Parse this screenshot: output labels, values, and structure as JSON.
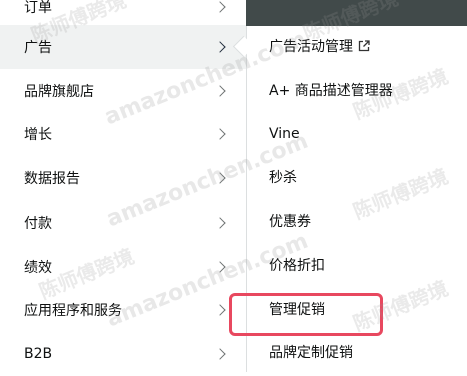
{
  "left_menu": {
    "items": [
      {
        "label": "订单",
        "active": false
      },
      {
        "label": "广告",
        "active": true
      },
      {
        "label": "品牌旗舰店",
        "active": false
      },
      {
        "label": "增长",
        "active": false
      },
      {
        "label": "数据报告",
        "active": false
      },
      {
        "label": "付款",
        "active": false
      },
      {
        "label": "绩效",
        "active": false
      },
      {
        "label": "应用程序和服务",
        "active": false
      },
      {
        "label": "B2B",
        "active": false
      }
    ]
  },
  "submenu": {
    "items": [
      {
        "label": "广告活动管理",
        "external": true
      },
      {
        "label": "A+ 商品描述管理器",
        "external": false
      },
      {
        "label": "Vine",
        "external": false
      },
      {
        "label": "秒杀",
        "external": false
      },
      {
        "label": "优惠券",
        "external": false
      },
      {
        "label": "价格折扣",
        "external": false
      },
      {
        "label": "管理促销",
        "external": false
      },
      {
        "label": "品牌定制促销",
        "external": false
      }
    ],
    "highlighted_item": "管理促销"
  },
  "watermark": {
    "text_en": "amazonchen.com",
    "text_cn": "陈师傅跨境"
  },
  "colors": {
    "highlight_border": "#e8485f",
    "active_bg": "#f0f2f2",
    "top_bar": "#414a4a"
  }
}
